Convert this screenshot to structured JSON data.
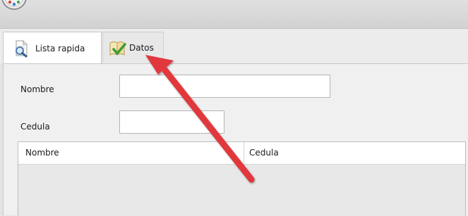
{
  "tabs": [
    {
      "label": "Lista rapida",
      "icon": "magnifier-page-icon",
      "active": true
    },
    {
      "label": "Datos",
      "icon": "checkmark-document-icon",
      "active": false
    }
  ],
  "form": {
    "nombre_label": "Nombre",
    "nombre_value": "",
    "cedula_label": "Cedula",
    "cedula_value": ""
  },
  "table": {
    "columns": [
      "Nombre",
      "Cedula"
    ],
    "rows": []
  },
  "colors": {
    "annotation_arrow": "#e0393e"
  }
}
